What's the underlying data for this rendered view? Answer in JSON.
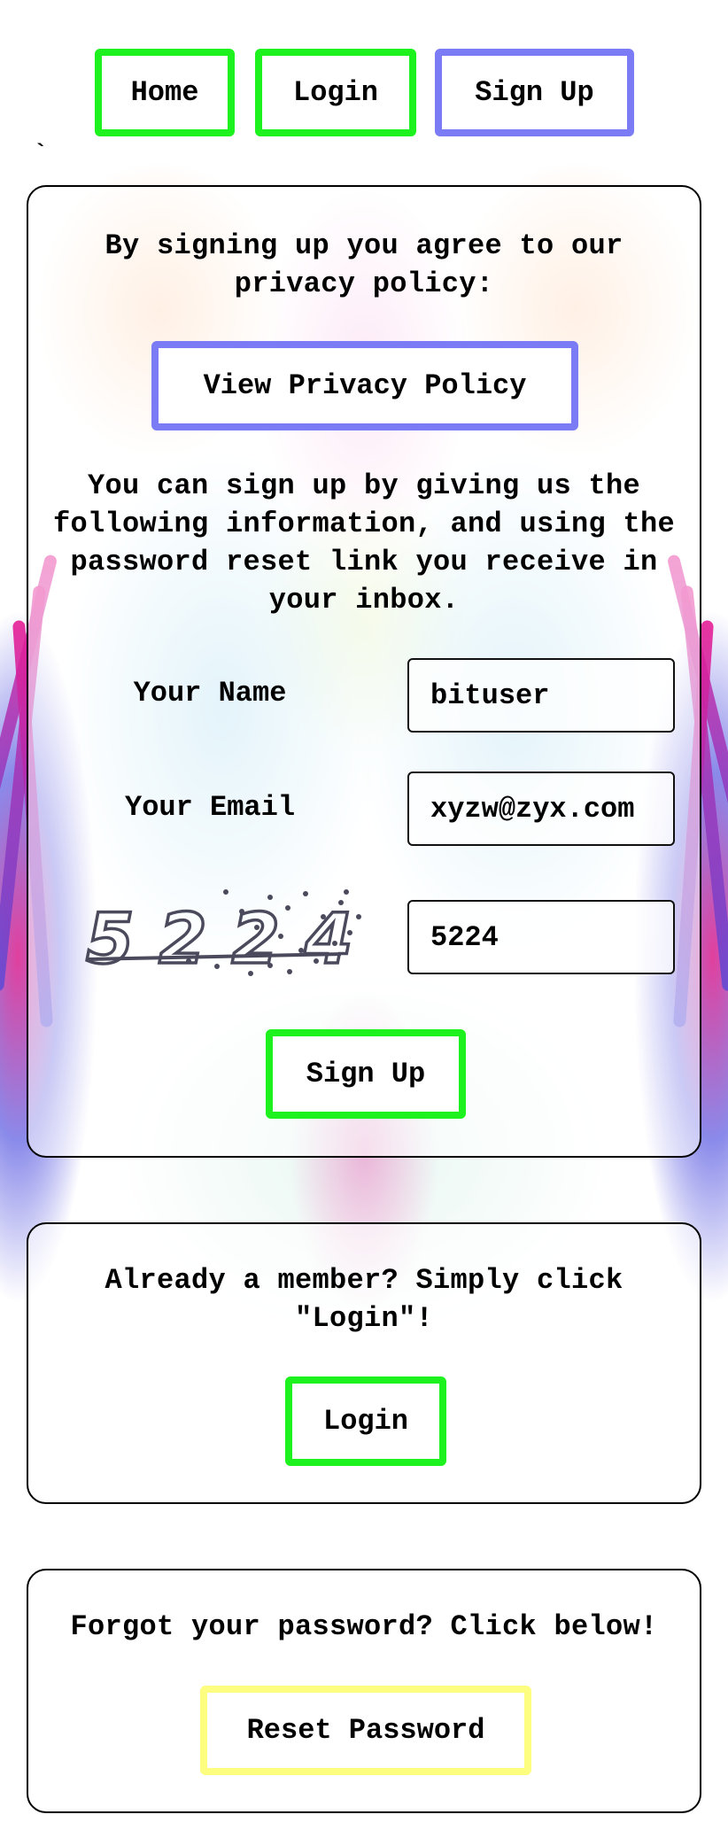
{
  "nav": {
    "home": "Home",
    "login": "Login",
    "signup": "Sign Up",
    "stray_mark": "`"
  },
  "signup_panel": {
    "agree_text": "By signing up you agree to our privacy policy:",
    "privacy_button": "View Privacy Policy",
    "info_text": "You can sign up by giving us the following information, and using the password reset link you receive in your inbox.",
    "name_label": "Your Name",
    "name_value": "bituser",
    "email_label": "Your Email",
    "email_value": "xyzw@zyx.com",
    "captcha_image_text": "5224",
    "captcha_value": "5224",
    "submit_button": "Sign Up"
  },
  "login_panel": {
    "text": "Already a member? Simply click \"Login\"!",
    "button": "Login"
  },
  "reset_panel": {
    "text": "Forgot your password? Click below!",
    "button": "Reset Password"
  },
  "colors": {
    "green_border": "#1ef21e",
    "blue_border": "#7b7bf6",
    "yellow_border": "#fdfd80"
  }
}
